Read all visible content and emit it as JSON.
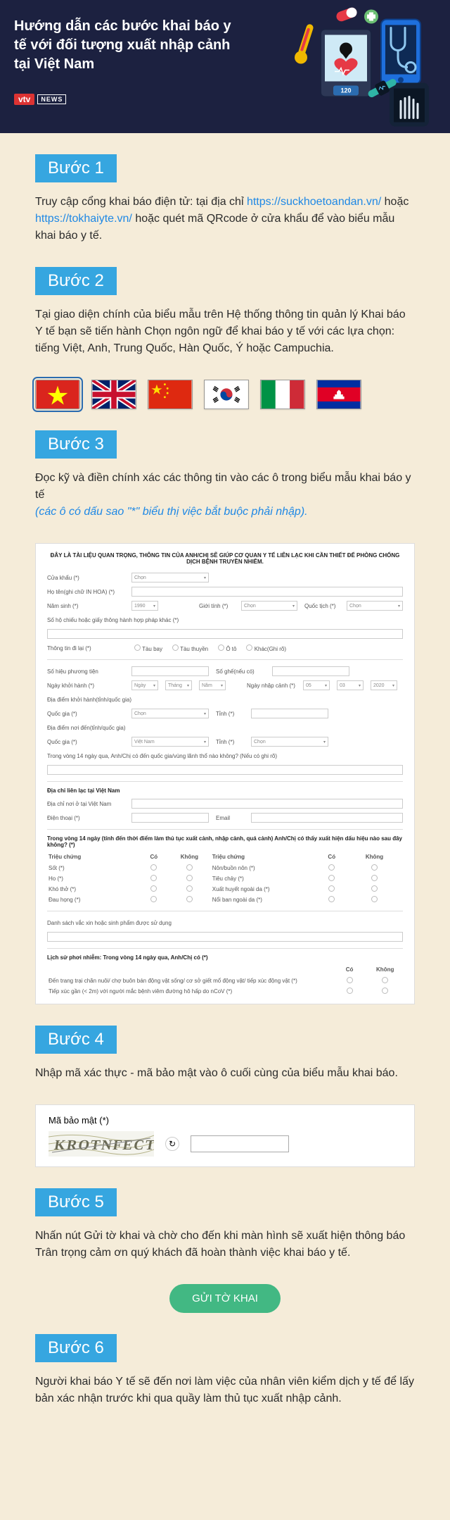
{
  "header": {
    "title": "Hướng dẫn các bước khai báo y tế với đối tượng xuất nhập cảnh tại Việt Nam",
    "logo_brand": "vtv",
    "logo_sub": "NEWS"
  },
  "steps": [
    {
      "label": "Bước 1",
      "pre": "Truy cập cổng khai báo điện tử: tại địa chỉ ",
      "link1": "https://suckhoetoandan.vn/",
      "mid": " hoặc ",
      "link2": "https://tokhaiyte.vn/",
      "post": " hoặc quét mã QRcode ở cửa khẩu để vào biểu mẫu khai báo y tế."
    },
    {
      "label": "Bước 2",
      "body": "Tại giao diện chính của biểu mẫu trên Hệ thống thông tin quản lý Khai báo Y tế bạn sẽ tiến hành Chọn ngôn ngữ để khai báo y tế với các lựa chọn: tiếng Việt, Anh, Trung Quốc, Hàn Quốc, Ý hoặc Campuchia."
    },
    {
      "label": "Bước 3",
      "body": "Đọc kỹ và điền chính xác các thông tin vào các ô trong biểu mẫu khai báo y tế",
      "note": "(các ô có dấu sao \"*\" biểu thị việc bắt buộc phải nhập)."
    },
    {
      "label": "Bước 4",
      "body": "Nhập mã xác thực - mã bảo mật vào ô cuối cùng của biểu mẫu khai báo."
    },
    {
      "label": "Bước 5",
      "body": "Nhấn nút Gửi tờ khai và chờ cho đến khi màn hình sẽ xuất hiện thông báo Trân trọng cảm ơn quý khách đã hoàn thành việc khai báo y tế."
    },
    {
      "label": "Bước 6",
      "body": "Người khai báo Y tế sẽ đến nơi làm việc của nhân viên kiểm dịch y tế để lấy bản xác nhận trước khi qua quầy làm thủ tục xuất nhập cảnh."
    }
  ],
  "flags": [
    "Vietnam",
    "United Kingdom",
    "China",
    "South Korea",
    "Italy",
    "Cambodia"
  ],
  "form": {
    "heading": "ĐÂY LÀ TÀI LIỆU QUAN TRỌNG, THÔNG TIN CỦA ANH/CHỊ SẼ GIÚP CƠ QUAN Y TẾ LIÊN LẠC KHI CẦN THIẾT ĐỂ PHÒNG CHỐNG DỊCH BỆNH TRUYỀN NHIỄM.",
    "gate": "Cửa khẩu (*)",
    "gate_ph": "Chọn",
    "name": "Họ tên(ghi chữ IN HOA) (*)",
    "yob": "Năm sinh (*)",
    "yob_v": "1990",
    "gender": "Giới tính (*)",
    "gender_ph": "Chọn",
    "nation": "Quốc tịch (*)",
    "nation_ph": "Chọn",
    "passport": "Số hộ chiếu hoặc giấy thông hành hợp pháp khác (*)",
    "transport": "Thông tin đi lại (*)",
    "t1": "Tàu bay",
    "t2": "Tàu thuyền",
    "t3": "Ô tô",
    "t4": "Khác(Ghi rõ)",
    "vehicle_no": "Số hiệu phương tiện",
    "seat_no": "Số ghế(nếu có)",
    "depart_date": "Ngày khởi hành (*)",
    "arrive_date": "Ngày nhập cảnh (*)",
    "d_day": "Ngày",
    "d_mon": "Tháng",
    "d_yr": "Năm",
    "a_day": "05",
    "a_mon": "03",
    "a_yr": "2020",
    "depart_place": "Địa điểm khởi hành(tỉnh/quốc gia)",
    "country": "Quốc gia (*)",
    "province": "Tỉnh (*)",
    "dest_place": "Địa điểm nơi đến(tỉnh/quốc gia)",
    "vn": "Việt Nam",
    "q21": "Trong vòng 14 ngày qua, Anh/Chị có đến quốc gia/vùng lãnh thổ nào không? (Nếu có ghi rõ)",
    "contact_hdr": "Địa chỉ liên lạc tại Việt Nam",
    "addr": "Địa chỉ nơi ở tại Việt Nam",
    "phone": "Điện thoại (*)",
    "email": "Email",
    "symptom_q": "Trong vòng 14 ngày (tính đến thời điểm làm thủ tục xuất cảnh, nhập cảnh, quá cảnh) Anh/Chị có thấy xuất hiện dấu hiệu nào sau đây không? (*)",
    "col_sym": "Triệu chứng",
    "col_yes": "Có",
    "col_no": "Không",
    "s1": "Sốt (*)",
    "s2": "Ho (*)",
    "s3": "Khó thở (*)",
    "s4": "Đau họng (*)",
    "s5": "Nôn/buồn nôn (*)",
    "s6": "Tiêu chảy (*)",
    "s7": "Xuất huyết ngoài da (*)",
    "s8": "Nổi ban ngoài da (*)",
    "vaccine": "Danh sách vắc xin hoặc sinh phẩm được sử dụng",
    "history": "Lịch sử phơi nhiễm: Trong vòng 14 ngày qua, Anh/Chị có (*)",
    "h1": "Đến trang trại chăn nuôi/ chợ buôn bán động vật sống/ cơ sở giết mổ động vật/ tiếp xúc động vật (*)",
    "h2": "Tiếp xúc gần (< 2m) với người mắc bệnh viêm đường hô hấp do nCoV (*)"
  },
  "captcha": {
    "label": "Mã bảo mật (*)"
  },
  "submit": {
    "label": "GỬI TỜ KHAI"
  }
}
